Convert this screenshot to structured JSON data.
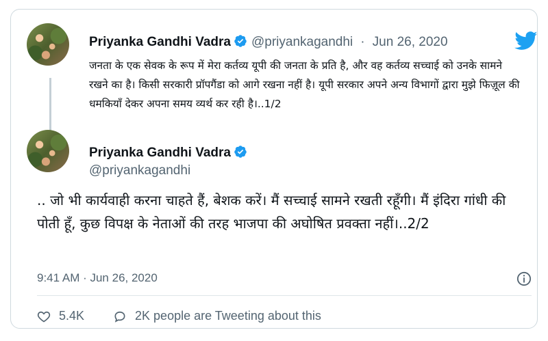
{
  "tweet1": {
    "name": "Priyanka Gandhi Vadra",
    "handle": "@priyankagandhi",
    "separator": "·",
    "date": "Jun 26, 2020",
    "text": "जनता के एक सेवक के रूप में मेरा कर्तव्य यूपी की जनता के प्रति है, और वह कर्तव्य सच्चाई को उनके सामने रखने का है। किसी सरकारी प्रॉपगैंडा को आगे रखना नहीं है। यूपी सरकार अपने अन्य विभागों द्वारा मुझे फिज़ूल की धमकियाँ देकर अपना समय व्यर्थ कर रही है।..1/2"
  },
  "tweet2": {
    "name": "Priyanka Gandhi Vadra",
    "handle": "@priyankagandhi",
    "text": ".. जो भी कार्यवाही करना चाहते हैं, बेशक करें। मैं सच्चाई सामने रखती रहूँगी। मैं इंदिरा गांधी की पोती हूँ, कुछ विपक्ष के नेताओं की तरह भाजपा की अघोषित प्रवक्ता नहीं।..2/2",
    "timestamp": "9:41 AM · Jun 26, 2020"
  },
  "actions": {
    "like_count": "5.4K",
    "tweeting_label": "2K people are Tweeting about this"
  },
  "icons": {
    "verified": "verified-badge-icon",
    "twitter": "twitter-bird-icon",
    "info": "info-icon",
    "heart": "heart-icon",
    "comment": "comment-bubble-icon"
  },
  "colors": {
    "verified_blue": "#1d9bf0",
    "twitter_blue": "#1da1f2",
    "muted_text": "#536471",
    "border": "#cfd9de"
  }
}
